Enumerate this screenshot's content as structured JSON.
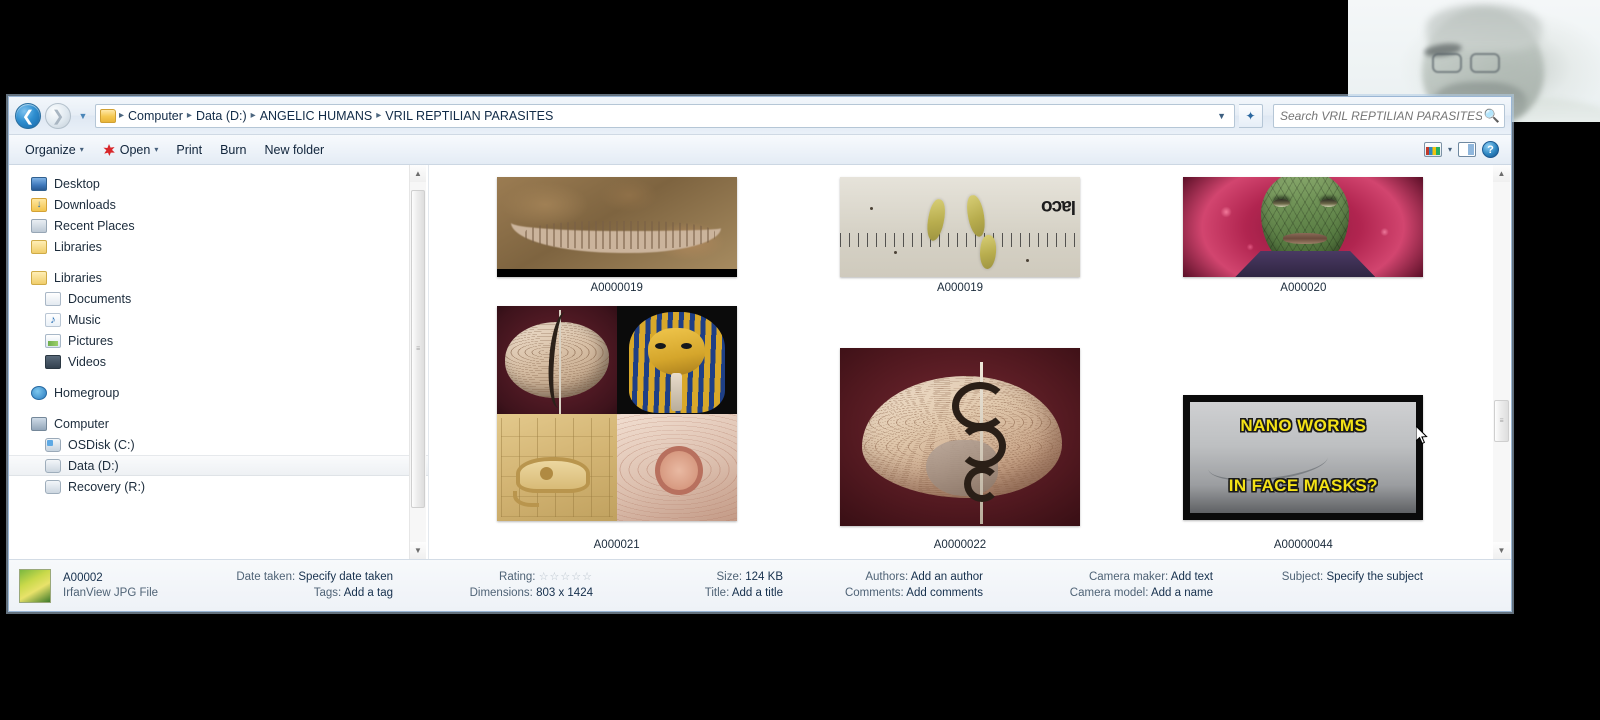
{
  "window": {
    "title": "VRIL REPTILIAN PARASITES"
  },
  "addressbar": {
    "back_icon": "back-arrow-icon",
    "forward_icon": "forward-arrow-icon",
    "history_icon": "history-dropdown-icon",
    "folder_icon": "folder-icon",
    "breadcrumbs": [
      "Computer",
      "Data (D:)",
      "ANGELIC HUMANS",
      "VRIL REPTILIAN PARASITES"
    ],
    "separator": "▸",
    "dropdown_icon": "chevron-down-icon",
    "refresh_icon": "refresh-icon",
    "refresh_glyph": "✦"
  },
  "search": {
    "placeholder": "Search VRIL REPTILIAN PARASITES",
    "value": "",
    "icon": "search-icon"
  },
  "toolbar": {
    "organize": "Organize",
    "open": "Open",
    "print": "Print",
    "burn": "Burn",
    "new_folder": "New folder",
    "caret": "▾",
    "views_icon": "change-view-icon",
    "preview_pane_icon": "preview-pane-icon",
    "help_icon": "help-icon",
    "help_glyph": "?"
  },
  "sidebar": {
    "groups": [
      {
        "items": [
          {
            "label": "Desktop",
            "icon": "desktop-icon",
            "indent": false,
            "selected": false
          },
          {
            "label": "Downloads",
            "icon": "downloads-folder-icon",
            "indent": false,
            "selected": false
          },
          {
            "label": "Recent Places",
            "icon": "recent-places-icon",
            "indent": false,
            "selected": false
          },
          {
            "label": "Libraries",
            "icon": "libraries-icon",
            "indent": false,
            "selected": false
          }
        ]
      },
      {
        "items": [
          {
            "label": "Libraries",
            "icon": "libraries-icon",
            "indent": false,
            "selected": false
          },
          {
            "label": "Documents",
            "icon": "documents-icon",
            "indent": true,
            "selected": false
          },
          {
            "label": "Music",
            "icon": "music-icon",
            "indent": true,
            "selected": false
          },
          {
            "label": "Pictures",
            "icon": "pictures-icon",
            "indent": true,
            "selected": false
          },
          {
            "label": "Videos",
            "icon": "videos-icon",
            "indent": true,
            "selected": false
          }
        ]
      },
      {
        "items": [
          {
            "label": "Homegroup",
            "icon": "homegroup-icon",
            "indent": false,
            "selected": false
          }
        ]
      },
      {
        "items": [
          {
            "label": "Computer",
            "icon": "computer-icon",
            "indent": false,
            "selected": false
          },
          {
            "label": "OSDisk (C:)",
            "icon": "os-drive-icon",
            "indent": true,
            "selected": false
          },
          {
            "label": "Data (D:)",
            "icon": "drive-icon",
            "indent": true,
            "selected": true
          },
          {
            "label": "Recovery (R:)",
            "icon": "drive-icon",
            "indent": true,
            "selected": false
          }
        ]
      }
    ]
  },
  "files": {
    "rows": [
      [
        {
          "name": "A0000019",
          "thumb": "worm-in-soil-thumbnail"
        },
        {
          "name": "A000019",
          "thumb": "larvae-on-ruler-thumbnail"
        },
        {
          "name": "A000020",
          "thumb": "reptilian-face-thumbnail"
        }
      ],
      [
        {
          "name": "A000021",
          "thumb": "brain-pharaoh-collage-thumbnail"
        },
        {
          "name": "A0000022",
          "thumb": "brain-caduceus-thumbnail"
        },
        {
          "name": "A00000044",
          "thumb": "nano-worms-face-masks-thumbnail"
        }
      ]
    ],
    "thumb_texts": {
      "larvae_label": "laco",
      "nano_line1": "NANO WORMS",
      "nano_line2": "IN FACE MASKS?"
    }
  },
  "details": {
    "file_name": "A00002",
    "file_type": "IrfanView JPG File",
    "fields": [
      {
        "key": "Date taken:",
        "value": "Specify date taken"
      },
      {
        "key": "Tags:",
        "value": "Add a tag"
      },
      {
        "key": "Rating:",
        "value": "☆☆☆☆☆"
      },
      {
        "key": "Dimensions:",
        "value": "803 x 1424"
      },
      {
        "key": "Size:",
        "value": "124 KB"
      },
      {
        "key": "Title:",
        "value": "Add a title"
      },
      {
        "key": "Authors:",
        "value": "Add an author"
      },
      {
        "key": "Comments:",
        "value": "Add comments"
      },
      {
        "key": "Camera maker:",
        "value": "Add text"
      },
      {
        "key": "Camera model:",
        "value": "Add a name"
      },
      {
        "key": "Subject:",
        "value": "Specify the subject"
      }
    ]
  },
  "scrollbars": {
    "up_arrow": "▲",
    "down_arrow": "▼",
    "grip": "≡"
  }
}
